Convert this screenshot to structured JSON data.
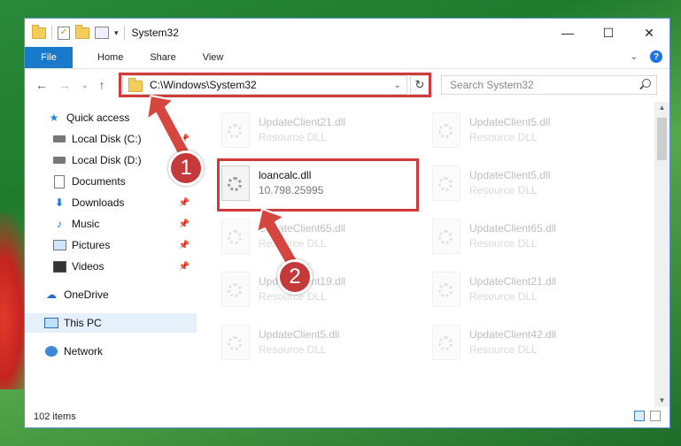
{
  "window": {
    "title": "System32",
    "controls": {
      "minimize": "—",
      "maximize": "☐",
      "close": "✕"
    }
  },
  "ribbon": {
    "file_tab": "File",
    "tabs": [
      "Home",
      "Share",
      "View"
    ],
    "help": "?"
  },
  "address": {
    "path": "C:\\Windows\\System32",
    "refresh": "↻",
    "search_placeholder": "Search System32"
  },
  "nav_buttons": {
    "back": "←",
    "forward": "→",
    "recent": "⌄",
    "up": "↑"
  },
  "sidebar": {
    "items": [
      {
        "label": "Quick access",
        "icon": "star-icon",
        "pinned": false
      },
      {
        "label": "Local Disk (C:)",
        "icon": "drive-icon",
        "pinned": true
      },
      {
        "label": "Local Disk (D:)",
        "icon": "drive-icon",
        "pinned": false
      },
      {
        "label": "Documents",
        "icon": "document-icon",
        "pinned": false
      },
      {
        "label": "Downloads",
        "icon": "download-icon",
        "pinned": true
      },
      {
        "label": "Music",
        "icon": "music-icon",
        "pinned": true
      },
      {
        "label": "Pictures",
        "icon": "pictures-icon",
        "pinned": true
      },
      {
        "label": "Videos",
        "icon": "videos-icon",
        "pinned": true
      },
      {
        "label": "OneDrive",
        "icon": "cloud-icon",
        "pinned": false
      },
      {
        "label": "This PC",
        "icon": "computer-icon",
        "pinned": false,
        "selected": true
      },
      {
        "label": "Network",
        "icon": "network-icon",
        "pinned": false
      }
    ]
  },
  "files": [
    {
      "name": "UpdateClient21.dll",
      "desc": "Resource DLL"
    },
    {
      "name": "UpdateClient5.dll",
      "desc": "Resource DLL"
    },
    {
      "name": "loancalc.dll",
      "desc": "10.798.25995"
    },
    {
      "name": "UpdateClient5.dll",
      "desc": "Resource DLL"
    },
    {
      "name": "UpdateClient65.dll",
      "desc": "Resource DLL"
    },
    {
      "name": "UpdateClient65.dll",
      "desc": "Resource DLL"
    },
    {
      "name": "UpdateClient19.dll",
      "desc": "Resource DLL"
    },
    {
      "name": "UpdateClient21.dll",
      "desc": "Resource DLL"
    },
    {
      "name": "UpdateClient5.dll",
      "desc": "Resource DLL"
    },
    {
      "name": "UpdateClient42.dll",
      "desc": "Resource DLL"
    }
  ],
  "status": {
    "item_count": "102 items"
  },
  "annotations": {
    "step1": "1",
    "step2": "2",
    "color": "#c43a3a"
  }
}
